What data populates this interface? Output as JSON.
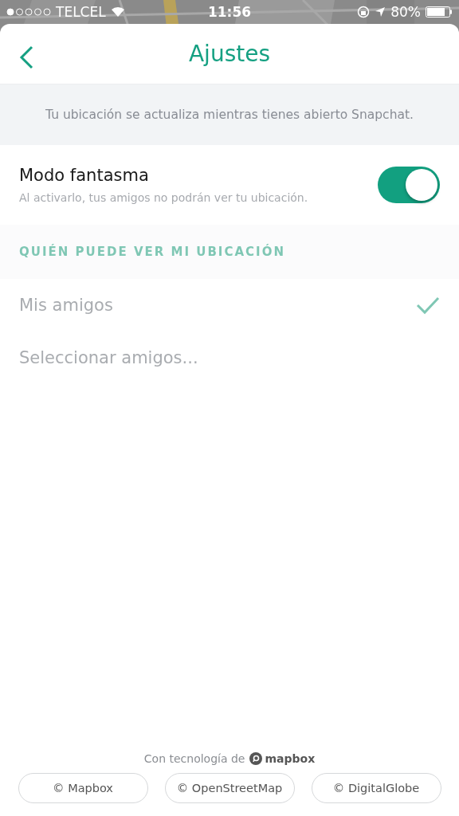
{
  "status_bar": {
    "carrier": "TELCEL",
    "time": "11:56",
    "battery": "80%"
  },
  "header": {
    "title": "Ajustes"
  },
  "info": "Tu ubicación se actualiza mientras tienes abierto Snapchat.",
  "ghost_mode": {
    "label": "Modo fantasma",
    "description": "Al activarlo, tus amigos no podrán ver tu ubicación.",
    "on": true
  },
  "section": {
    "title": "QUIÉN PUEDE VER MI UBICACIÓN",
    "disabled": true
  },
  "options": [
    {
      "label": "Mis amigos",
      "selected": true,
      "disabled": true
    },
    {
      "label": "Seleccionar amigos...",
      "selected": false,
      "disabled": true
    }
  ],
  "footer": {
    "powered_by": "Con tecnología de",
    "logo": "mapbox",
    "credits": [
      "© Mapbox",
      "© OpenStreetMap",
      "© DigitalGlobe"
    ]
  }
}
